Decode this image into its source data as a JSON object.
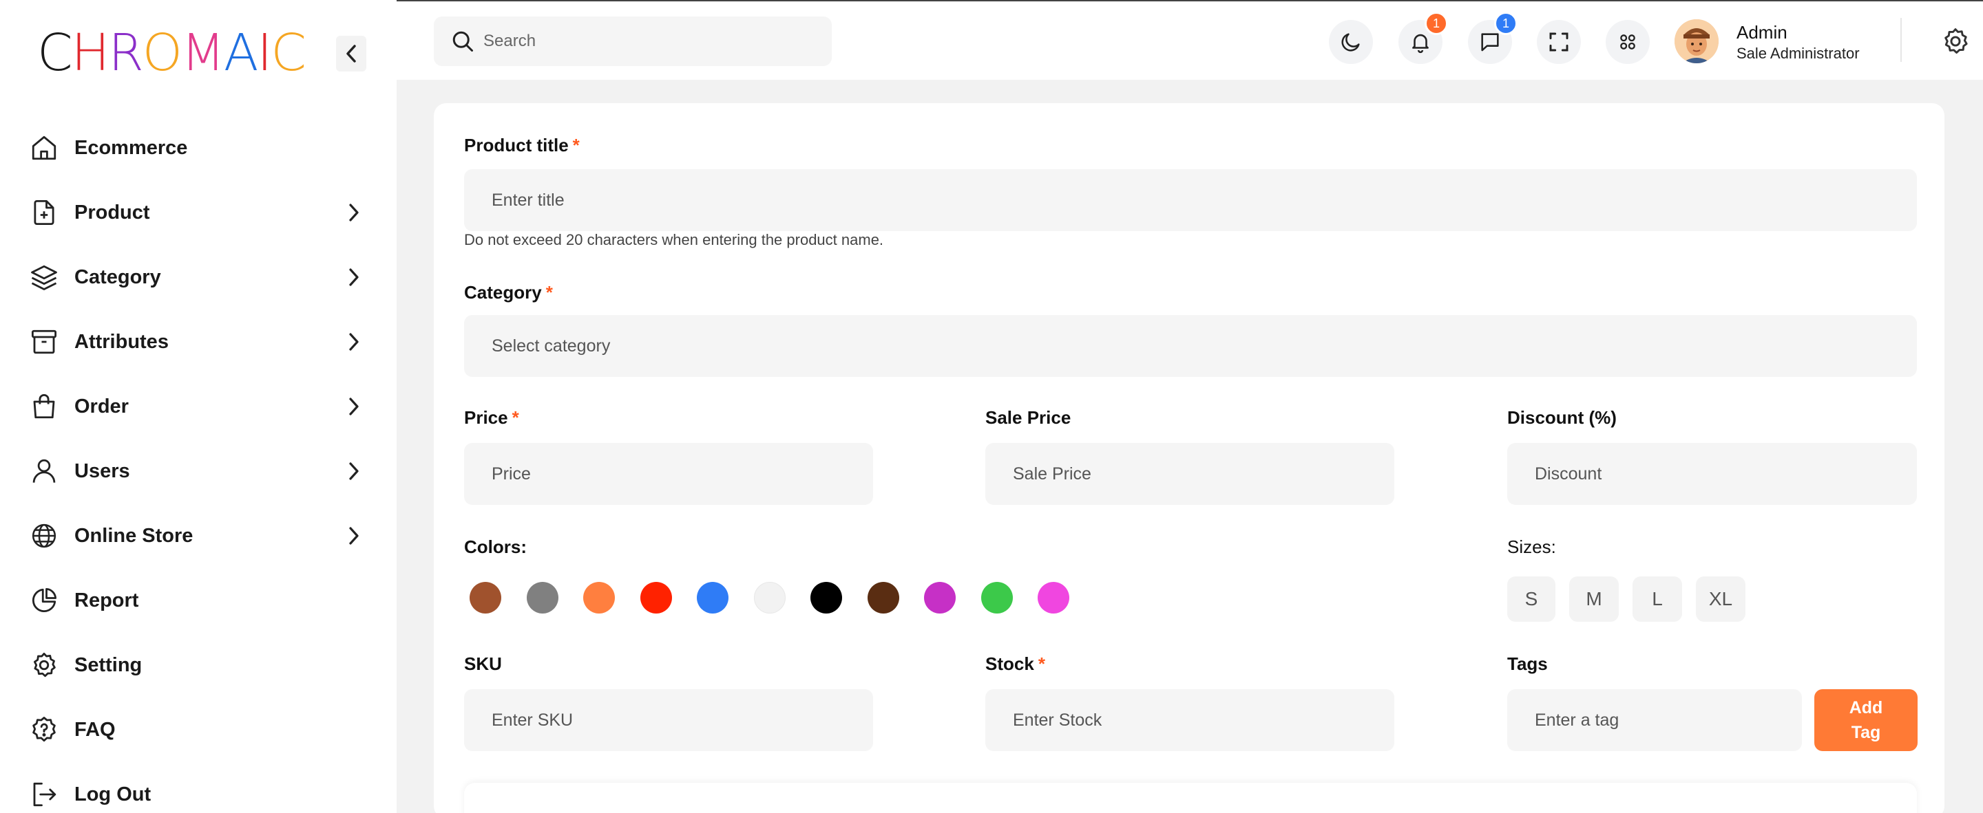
{
  "brand": {
    "letters": [
      {
        "char": "C",
        "color": "#1a1a1a"
      },
      {
        "char": "H",
        "color": "#e0282e"
      },
      {
        "char": "R",
        "color": "#8b2fc9"
      },
      {
        "char": "O",
        "color": "#f5a623"
      },
      {
        "char": "M",
        "color": "#e23c8c"
      },
      {
        "char": "A",
        "color": "#1f6fe0"
      },
      {
        "char": "I",
        "color": "#e0282e"
      },
      {
        "char": "C",
        "color": "#f5a623"
      }
    ]
  },
  "sidebar": {
    "items": [
      {
        "label": "Ecommerce",
        "icon": "home-icon",
        "has_chevron": false
      },
      {
        "label": "Product",
        "icon": "file-plus-icon",
        "has_chevron": true
      },
      {
        "label": "Category",
        "icon": "layers-icon",
        "has_chevron": true
      },
      {
        "label": "Attributes",
        "icon": "archive-icon",
        "has_chevron": true
      },
      {
        "label": "Order",
        "icon": "shopping-bag-icon",
        "has_chevron": true
      },
      {
        "label": "Users",
        "icon": "user-icon",
        "has_chevron": true
      },
      {
        "label": "Online Store",
        "icon": "globe-icon",
        "has_chevron": true
      },
      {
        "label": "Report",
        "icon": "pie-chart-icon",
        "has_chevron": false
      },
      {
        "label": "Setting",
        "icon": "gear-icon",
        "has_chevron": false
      },
      {
        "label": "FAQ",
        "icon": "help-badge-icon",
        "has_chevron": false
      },
      {
        "label": "Log Out",
        "icon": "logout-icon",
        "has_chevron": false
      }
    ]
  },
  "header": {
    "search_placeholder": "Search",
    "notifications_count": "1",
    "messages_count": "1",
    "user": {
      "name": "Admin",
      "role": "Sale Administrator"
    }
  },
  "form": {
    "title": {
      "label": "Product title",
      "required": "*",
      "placeholder": "Enter title",
      "hint": "Do not exceed 20 characters when entering the product name."
    },
    "category": {
      "label": "Category",
      "required": "*",
      "selected": "Select category"
    },
    "price": {
      "label": "Price",
      "required": "*",
      "placeholder": "Price"
    },
    "sale_price": {
      "label": "Sale Price",
      "placeholder": "Sale Price"
    },
    "discount": {
      "label": "Discount (%)",
      "placeholder": "Discount"
    },
    "colors": {
      "label": "Colors:",
      "swatches": [
        "#a0522d",
        "#808080",
        "#ff7f3f",
        "#ff2200",
        "#2f7cf6",
        "#f2f2f2",
        "#000000",
        "#5a2d12",
        "#c630c6",
        "#3cc94a",
        "#f046e0"
      ]
    },
    "sizes": {
      "label": "Sizes:",
      "options": [
        "S",
        "M",
        "L",
        "XL"
      ]
    },
    "sku": {
      "label": "SKU",
      "placeholder": "Enter SKU"
    },
    "stock": {
      "label": "Stock",
      "required": "*",
      "placeholder": "Enter Stock"
    },
    "tags": {
      "label": "Tags",
      "placeholder": "Enter a tag",
      "add_button_line1": "Add",
      "add_button_line2": "Tag"
    }
  },
  "colors": {
    "accent": "#ff7a35",
    "required": "#ff5a1f"
  }
}
